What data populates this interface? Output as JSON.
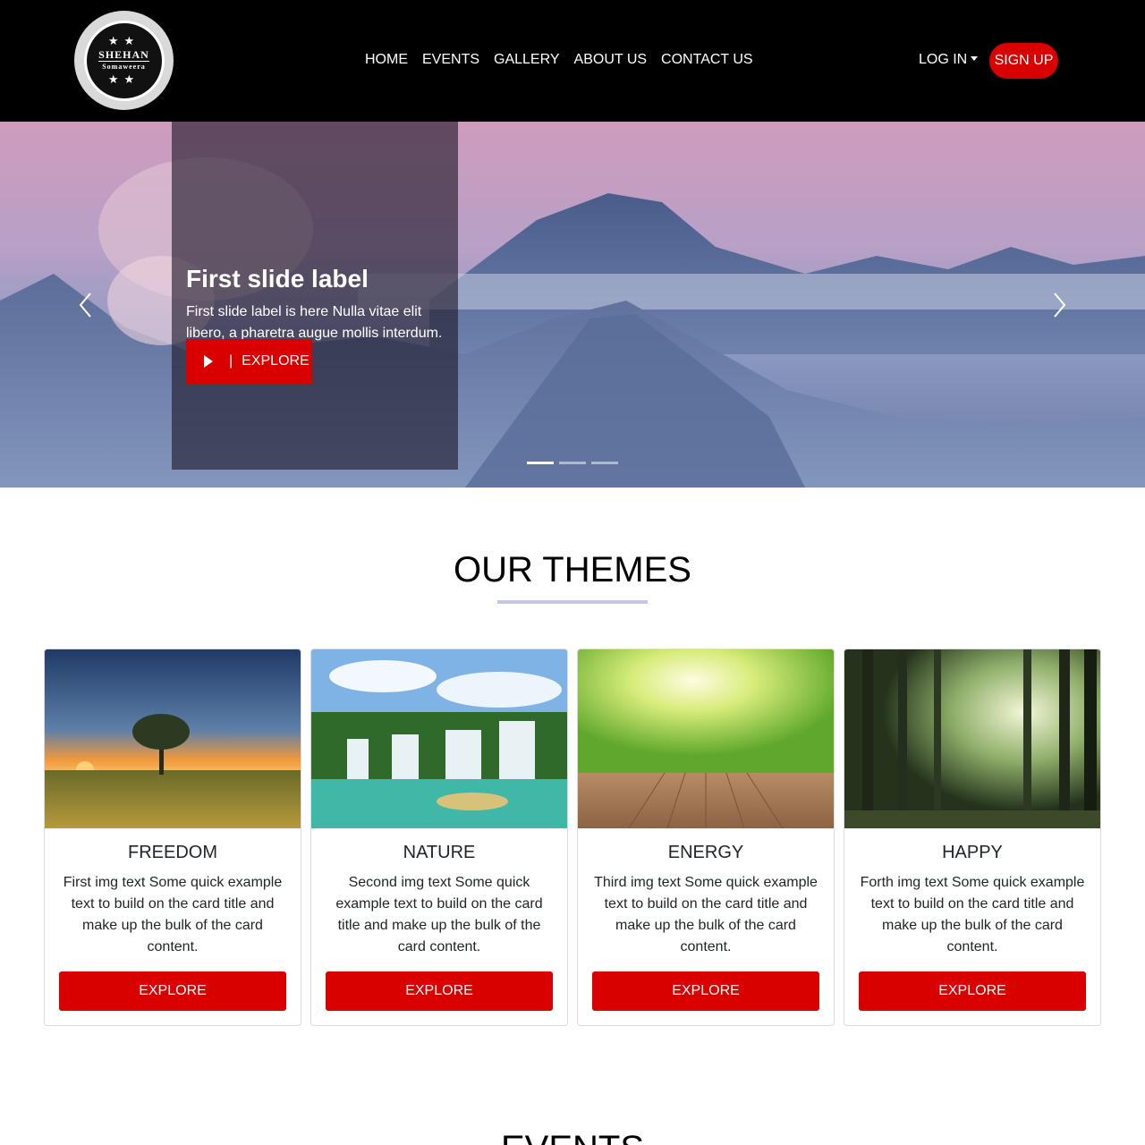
{
  "brand": {
    "name": "SHEHAN",
    "sub": "Somaweera",
    "stars": "★★"
  },
  "nav": {
    "items": [
      {
        "label": "HOME"
      },
      {
        "label": "EVENTS"
      },
      {
        "label": "GALLERY"
      },
      {
        "label": "ABOUT US"
      },
      {
        "label": "CONTACT US"
      }
    ],
    "login_label": "LOG IN",
    "signup_label": "SIGN UP"
  },
  "hero": {
    "title": "First slide label",
    "text": "First slide label is here Nulla vitae elit libero, a pharetra augue mollis interdum.",
    "button_label": "EXPLORE",
    "button_separator": "|",
    "slides_count": 3,
    "active_slide": 1
  },
  "themes": {
    "title": "OUR THEMES",
    "cards": [
      {
        "title": "FREEDOM",
        "text": "First img text Some quick example text to build on the card title and make up the bulk of the card content.",
        "button_label": "EXPLORE"
      },
      {
        "title": "NATURE",
        "text": "Second img text Some quick example text to build on the card title and make up the bulk of the card content.",
        "button_label": "EXPLORE"
      },
      {
        "title": "ENERGY",
        "text": "Third img text Some quick example text to build on the card title and make up the bulk of the card content.",
        "button_label": "EXPLORE"
      },
      {
        "title": "HAPPY",
        "text": "Forth img text Some quick example text to build on the card title and make up the bulk of the card content.",
        "button_label": "EXPLORE"
      }
    ]
  },
  "events": {
    "title": "EVENTS"
  },
  "colors": {
    "accent": "#d90000",
    "navbar": "#000000",
    "underline": "#c5c5e6"
  }
}
